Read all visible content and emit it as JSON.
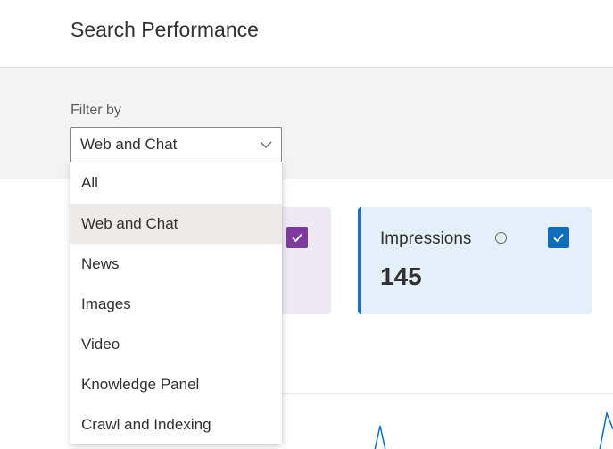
{
  "header": {
    "title": "Search Performance"
  },
  "filter": {
    "label": "Filter by",
    "selected": "Web and Chat",
    "options": [
      "All",
      "Web and Chat",
      "News",
      "Images",
      "Video",
      "Knowledge Panel",
      "Crawl and Indexing"
    ]
  },
  "cards": {
    "clicks": {
      "checked": true,
      "color": "#7d3ba0"
    },
    "impressions": {
      "label": "Impressions",
      "value": "145",
      "checked": true,
      "color": "#0f6cbd"
    }
  },
  "icons": {
    "chevron": "chevron-down-icon",
    "info": "info-icon",
    "check": "checkmark-icon"
  }
}
